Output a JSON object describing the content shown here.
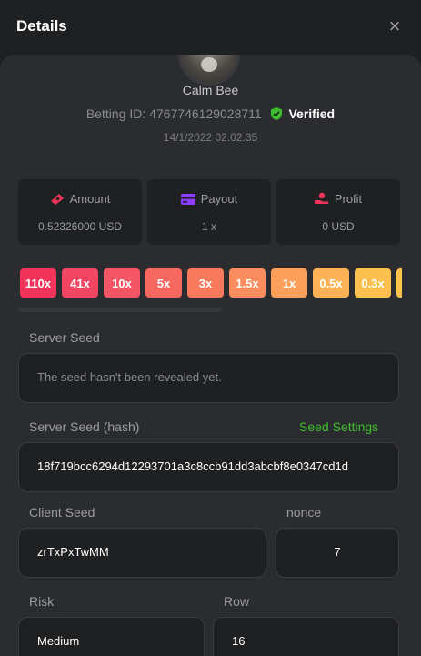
{
  "header": {
    "title": "Details",
    "close_label": "×"
  },
  "profile": {
    "username": "Calm Bee",
    "betting_id_label": "Betting ID: 4767746129028711",
    "verified_label": "Verified",
    "date": "14/1/2022 02.02.35"
  },
  "stats": [
    {
      "label": "Amount",
      "value": "0.52326000 USD",
      "icon": "money-icon"
    },
    {
      "label": "Payout",
      "value": "1 x",
      "icon": "card-icon"
    },
    {
      "label": "Profit",
      "value": "0 USD",
      "icon": "hand-icon"
    }
  ],
  "multipliers": [
    {
      "label": "110x",
      "color": "#f2335a"
    },
    {
      "label": "41x",
      "color": "#f24561"
    },
    {
      "label": "10x",
      "color": "#f45665"
    },
    {
      "label": "5x",
      "color": "#f6685f"
    },
    {
      "label": "3x",
      "color": "#f8795c"
    },
    {
      "label": "1.5x",
      "color": "#fa8c5d"
    },
    {
      "label": "1x",
      "color": "#fb9f5a"
    },
    {
      "label": "0.5x",
      "color": "#fcb255"
    },
    {
      "label": "0.3x",
      "color": "#fdbf4e"
    },
    {
      "label": "",
      "color": "#fdc24a"
    }
  ],
  "server_seed": {
    "label": "Server Seed",
    "value": "The seed hasn't been revealed yet."
  },
  "server_seed_hash": {
    "label": "Server Seed (hash)",
    "link": "Seed Settings",
    "value": "18f719bcc6294d12293701a3c8ccb91dd3abcbf8e0347cd1d"
  },
  "client_seed": {
    "label": "Client Seed",
    "value": "zrTxPxTwMM"
  },
  "nonce": {
    "label": "nonce",
    "value": "7"
  },
  "risk": {
    "label": "Risk",
    "value": "Medium"
  },
  "row": {
    "label": "Row",
    "value": "16"
  },
  "colors": {
    "accent_green": "#3fbf2f",
    "panel_bg": "#2b2c2f",
    "field_bg": "#1f2022"
  }
}
